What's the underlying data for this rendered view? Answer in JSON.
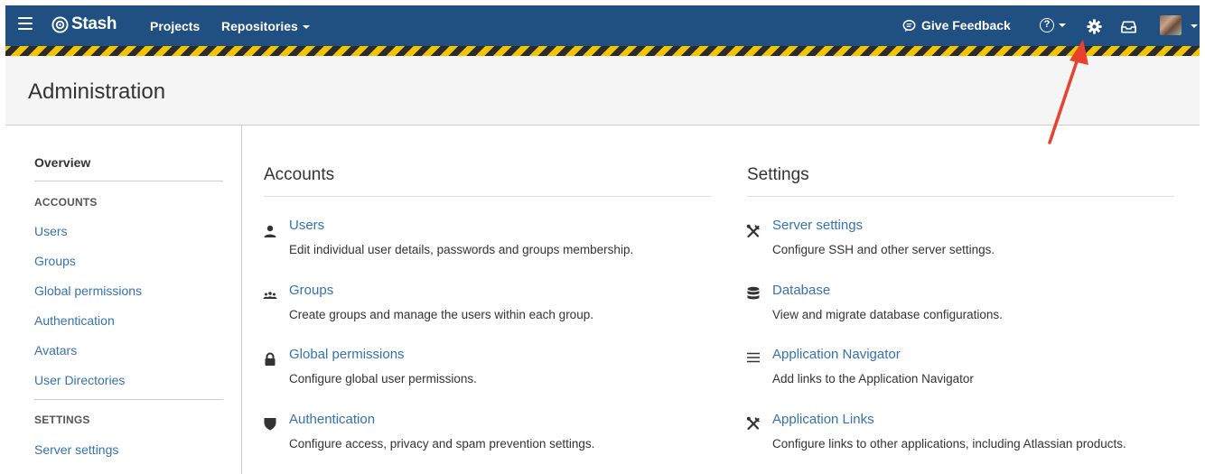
{
  "header": {
    "logo_text": "Stash",
    "nav": {
      "projects": "Projects",
      "repositories": "Repositories"
    },
    "feedback": "Give Feedback",
    "help_icon": "?",
    "bg_color": "#205081"
  },
  "page": {
    "title": "Administration"
  },
  "sidebar": {
    "overview": "Overview",
    "accounts_heading": "ACCOUNTS",
    "accounts": [
      "Users",
      "Groups",
      "Global permissions",
      "Authentication",
      "Avatars",
      "User Directories"
    ],
    "settings_heading": "SETTINGS",
    "settings": [
      "Server settings"
    ]
  },
  "accounts": {
    "title": "Accounts",
    "items": [
      {
        "icon": "user-icon",
        "title": "Users",
        "desc": "Edit individual user details, passwords and groups membership."
      },
      {
        "icon": "group-icon",
        "title": "Groups",
        "desc": "Create groups and manage the users within each group."
      },
      {
        "icon": "lock-icon",
        "title": "Global permissions",
        "desc": "Configure global user permissions."
      },
      {
        "icon": "shield-icon",
        "title": "Authentication",
        "desc": "Configure access, privacy and spam prevention settings."
      }
    ]
  },
  "settings": {
    "title": "Settings",
    "items": [
      {
        "icon": "tools-icon",
        "title": "Server settings",
        "desc": "Configure SSH and other server settings."
      },
      {
        "icon": "database-icon",
        "title": "Database",
        "desc": "View and migrate database configurations."
      },
      {
        "icon": "menu-icon",
        "title": "Application Navigator",
        "desc": "Add links to the Application Navigator"
      },
      {
        "icon": "tools-icon",
        "title": "Application Links",
        "desc": "Configure links to other applications, including Atlassian products."
      }
    ]
  },
  "colors": {
    "link": "#3572b0",
    "hazard_yellow": "#f2c500",
    "annotation": "#e8412c"
  }
}
